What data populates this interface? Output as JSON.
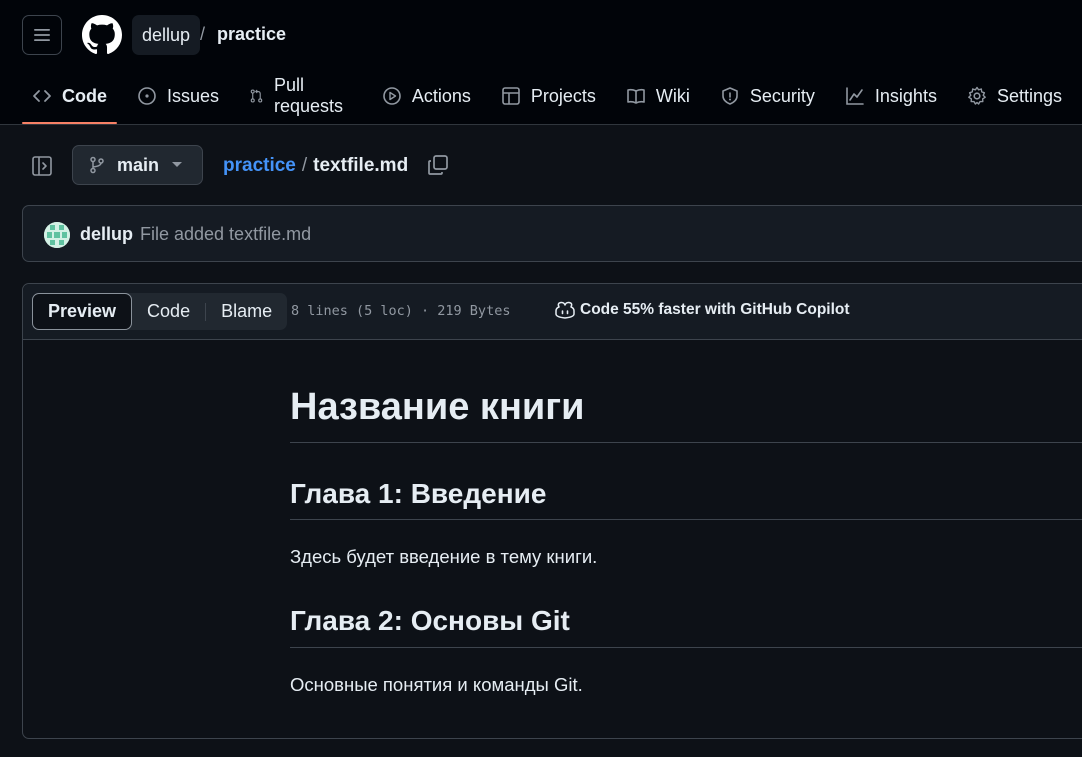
{
  "header": {
    "owner": "dellup",
    "separator": "/",
    "repo": "practice"
  },
  "tabs": [
    {
      "label": "Code",
      "icon": "code-icon",
      "active": true
    },
    {
      "label": "Issues",
      "icon": "issue-icon"
    },
    {
      "label": "Pull requests",
      "icon": "pull-request-icon"
    },
    {
      "label": "Actions",
      "icon": "play-icon"
    },
    {
      "label": "Projects",
      "icon": "table-icon"
    },
    {
      "label": "Wiki",
      "icon": "book-icon"
    },
    {
      "label": "Security",
      "icon": "shield-icon"
    },
    {
      "label": "Insights",
      "icon": "graph-icon"
    },
    {
      "label": "Settings",
      "icon": "gear-icon"
    }
  ],
  "branch": {
    "name": "main"
  },
  "breadcrumb": {
    "repo": "practice",
    "separator": "/",
    "file": "textfile.md"
  },
  "commit": {
    "author": "dellup",
    "message": "File added textfile.md"
  },
  "file_view": {
    "modes": [
      "Preview",
      "Code",
      "Blame"
    ],
    "active_mode": "Preview",
    "meta": "8 lines (5 loc) · 219 Bytes",
    "copilot_text": "Code 55% faster with GitHub Copilot"
  },
  "markdown": {
    "h1": "Название книги",
    "h2_1": "Глава 1: Введение",
    "p1": "Здесь будет введение в тему книги.",
    "h2_2": "Глава 2: Основы Git",
    "p2": "Основные понятия и команды Git."
  },
  "colors": {
    "background": "#0d1117",
    "header_bg": "#010409",
    "link": "#4493f8",
    "active_tab_underline": "#f78166"
  }
}
